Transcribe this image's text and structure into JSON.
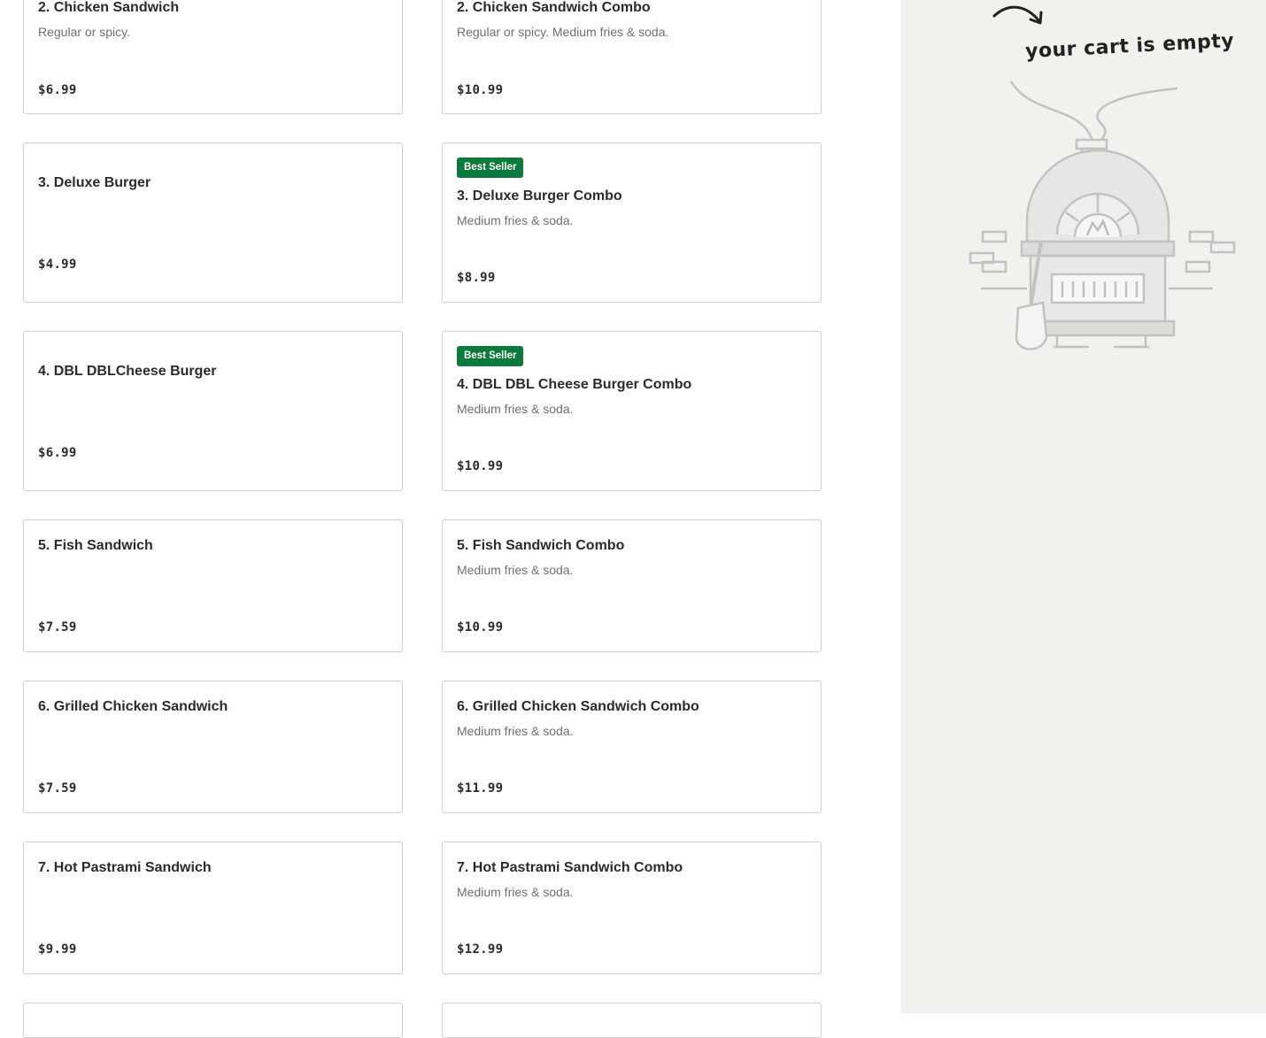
{
  "menu": {
    "items": [
      {
        "title": "2. Chicken Sandwich",
        "desc": "Regular or spicy.",
        "price": "$6.99"
      },
      {
        "title": "2. Chicken Sandwich Combo",
        "desc": "Regular or spicy. Medium fries & soda.",
        "price": "$10.99"
      },
      {
        "title": "3. Deluxe Burger",
        "price": "$4.99"
      },
      {
        "badge": "Best Seller",
        "title": "3. Deluxe Burger Combo",
        "desc": "Medium fries & soda.",
        "price": "$8.99"
      },
      {
        "title": "4. DBL DBLCheese Burger",
        "price": "$6.99"
      },
      {
        "badge": "Best Seller",
        "title": "4. DBL DBL Cheese Burger Combo",
        "desc": "Medium fries & soda.",
        "price": "$10.99"
      },
      {
        "title": "5. Fish Sandwich",
        "price": "$7.59"
      },
      {
        "title": "5. Fish Sandwich Combo",
        "desc": "Medium fries & soda.",
        "price": "$10.99"
      },
      {
        "title": "6. Grilled Chicken Sandwich",
        "price": "$7.59"
      },
      {
        "title": "6. Grilled Chicken Sandwich Combo",
        "desc": "Medium fries & soda.",
        "price": "$11.99"
      },
      {
        "title": "7. Hot Pastrami Sandwich",
        "price": "$9.99"
      },
      {
        "title": "7. Hot Pastrami Sandwich Combo",
        "desc": "Medium fries & soda.",
        "price": "$12.99"
      }
    ]
  },
  "cart": {
    "empty_text": "your cart is empty",
    "illustration_icon": "pizza-oven-icon",
    "arrow_icon": "curved-arrow-icon"
  },
  "colors": {
    "badge_bg": "#0b7a3b",
    "cart_bg": "#f2f1ee",
    "card_border": "#cfcfcf"
  }
}
